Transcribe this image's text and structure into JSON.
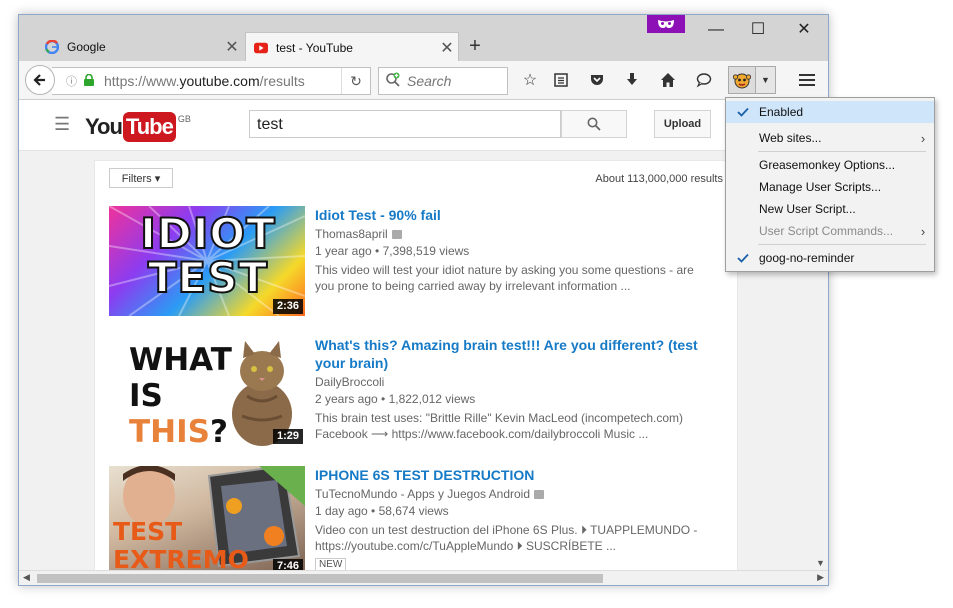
{
  "tabs": [
    {
      "label": "Google",
      "icon": "google-favicon"
    },
    {
      "label": "test - YouTube",
      "icon": "youtube-favicon"
    }
  ],
  "window_controls": {
    "minimize": "—",
    "maximize": "☐",
    "close": "✕"
  },
  "navbar": {
    "url_prefix": "https://www.",
    "url_domain": "youtube.com",
    "url_suffix": "/results",
    "search_placeholder": "Search"
  },
  "youtube": {
    "logo_you": "You",
    "logo_tube": "Tube",
    "logo_region": "GB",
    "search_query": "test",
    "upload_label": "Upload",
    "filters_label": "Filters ▾",
    "results_count": "About 113,000,000 results"
  },
  "videos": [
    {
      "title": "Idiot Test - 90% fail",
      "channel": "Thomas8april",
      "meta": "1 year ago • 7,398,519 views",
      "desc": "This video will test your idiot nature by asking you some questions - are you prone to being carried away by irrelevant information ...",
      "duration": "2:36",
      "thumb_text": "IDIOT TEST"
    },
    {
      "title": "What's this? Amazing brain test!!! Are you different? (test your brain)",
      "channel": "DailyBroccoli",
      "meta": "2 years ago • 1,822,012 views",
      "desc": "This brain test uses: \"Brittle Rille\" Kevin MacLeod (incompetech.com) Facebook ⟶ https://www.facebook.com/dailybroccoli Music ...",
      "duration": "1:29",
      "thumb_text_1": "WHAT",
      "thumb_text_2": "IS",
      "thumb_text_3": "THIS",
      "thumb_text_4": "?"
    },
    {
      "title": "IPHONE 6S TEST DESTRUCTION",
      "channel": "TuTecnoMundo - Apps y Juegos Android",
      "meta": "1 day ago • 58,674 views",
      "desc": "Video con un test destruction del iPhone 6S Plus. ⏵ TUAPPLEMUNDO - https://youtube.com/c/TuAppleMundo ⏵ SUSCRÍBETE ...",
      "duration": "7:46",
      "badge": "NEW",
      "thumb_text": "TEST EXTREMO"
    }
  ],
  "gm_menu": {
    "enabled": "Enabled",
    "web_sites": "Web sites...",
    "options": "Greasemonkey Options...",
    "manage": "Manage User Scripts...",
    "new_script": "New User Script...",
    "commands": "User Script Commands...",
    "script_1": "goog-no-reminder"
  },
  "colors": {
    "accent": "#167ac6",
    "youtube_red": "#cc181e",
    "private_purple": "#8c10b5"
  }
}
